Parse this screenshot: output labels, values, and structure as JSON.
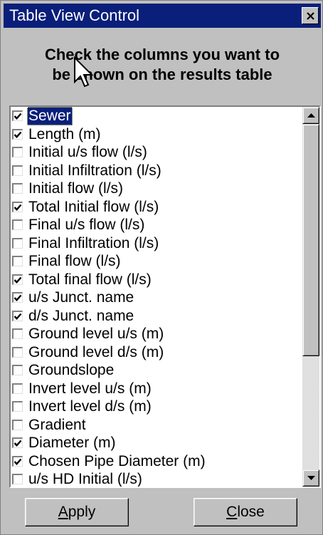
{
  "window": {
    "title": "Table View Control",
    "close_glyph": "×"
  },
  "instruction": {
    "line1": "Check the columns you want to",
    "line2": "be shown on the results table"
  },
  "columns": [
    {
      "label": "Sewer",
      "checked": true,
      "selected": true
    },
    {
      "label": "Length (m)",
      "checked": true
    },
    {
      "label": "Initial u/s flow (l/s)",
      "checked": false
    },
    {
      "label": "Initial Infiltration (l/s)",
      "checked": false
    },
    {
      "label": "Initial flow (l/s)",
      "checked": false
    },
    {
      "label": "Total Initial flow (l/s)",
      "checked": true
    },
    {
      "label": "Final u/s flow (l/s)",
      "checked": false
    },
    {
      "label": "Final Infiltration (l/s)",
      "checked": false
    },
    {
      "label": "Final flow (l/s)",
      "checked": false
    },
    {
      "label": "Total final flow (l/s)",
      "checked": true
    },
    {
      "label": "u/s Junct. name",
      "checked": true
    },
    {
      "label": "d/s Junct. name",
      "checked": true
    },
    {
      "label": "Ground level u/s (m)",
      "checked": false
    },
    {
      "label": "Ground level d/s (m)",
      "checked": false
    },
    {
      "label": "Groundslope",
      "checked": false
    },
    {
      "label": "Invert level u/s (m)",
      "checked": false
    },
    {
      "label": "Invert level d/s (m)",
      "checked": false
    },
    {
      "label": "Gradient",
      "checked": false
    },
    {
      "label": "Diameter (m)",
      "checked": true
    },
    {
      "label": "Chosen Pipe Diameter (m)",
      "checked": true
    },
    {
      "label": "u/s HD Initial (l/s)",
      "checked": false
    }
  ],
  "buttons": {
    "apply": {
      "mnemonic": "A",
      "rest": "pply"
    },
    "close": {
      "mnemonic": "C",
      "rest": "lose"
    }
  },
  "colors": {
    "titlebar": "#0a1f7a",
    "selection": "#0a1f7a",
    "face": "#c0c0c0"
  }
}
